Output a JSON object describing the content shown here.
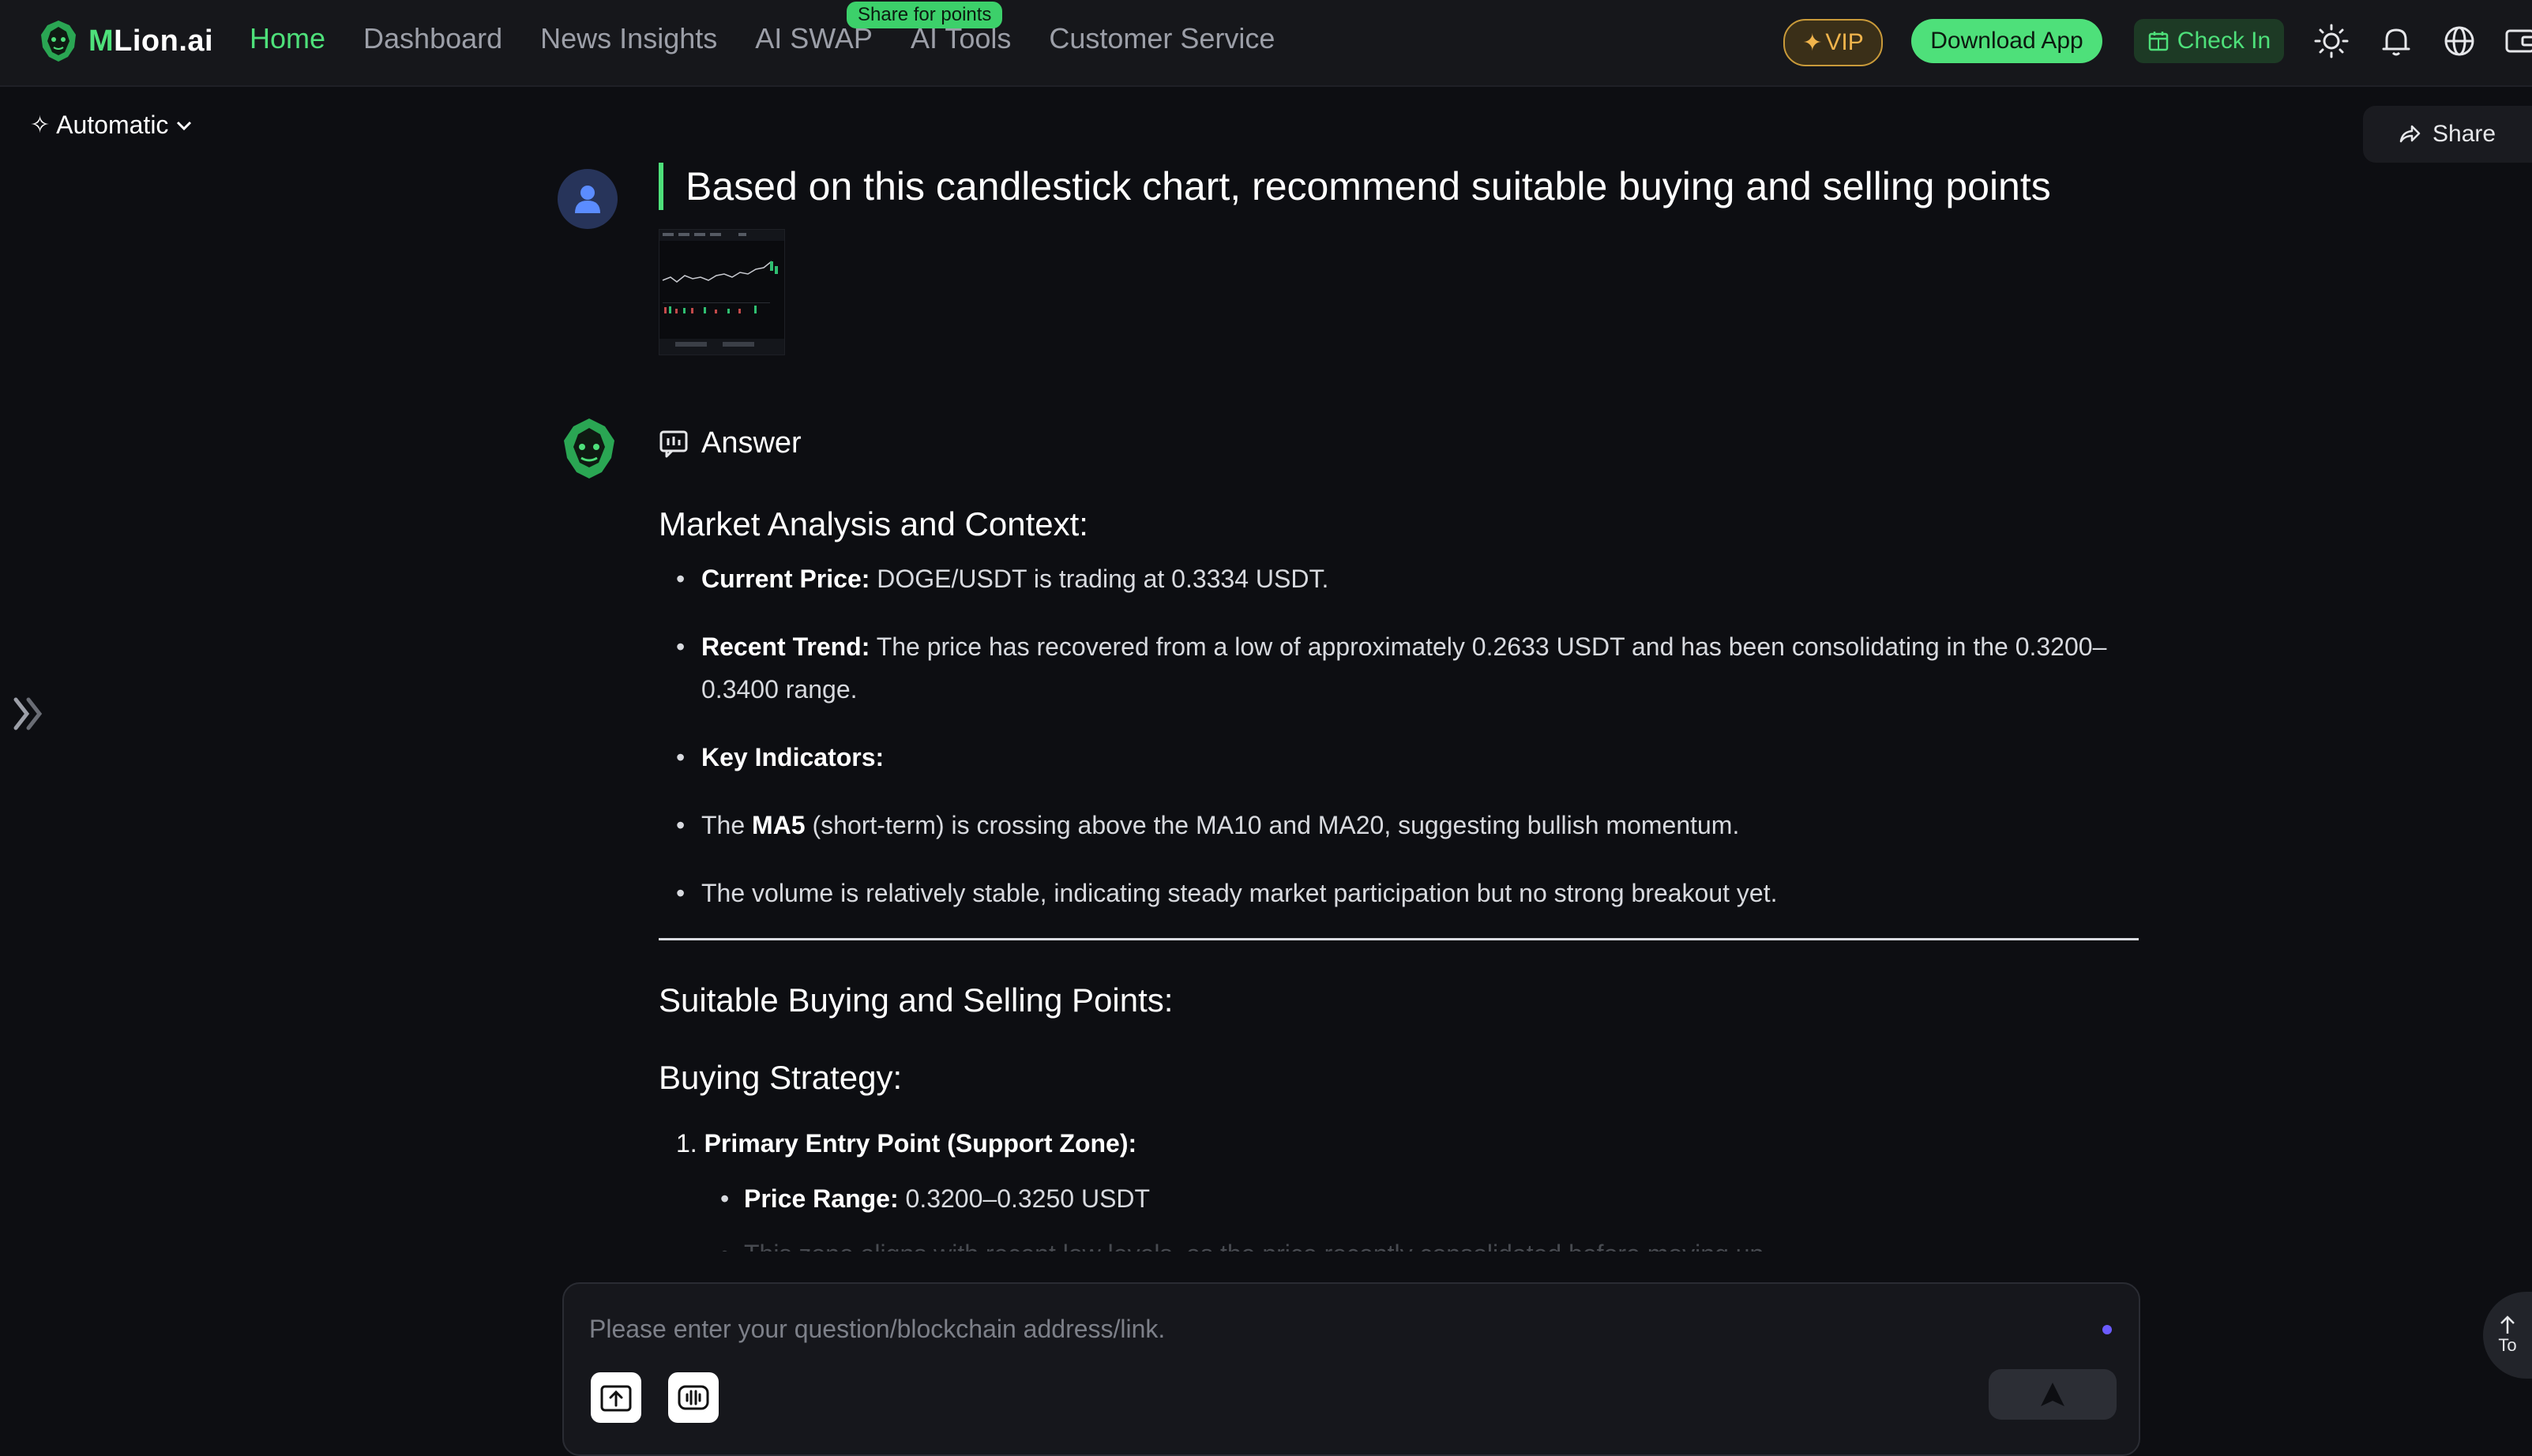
{
  "brand": {
    "logo_prefix": "M",
    "logo_rest": "Lion.ai"
  },
  "nav": {
    "items": [
      "Home",
      "Dashboard",
      "News Insights",
      "AI SWAP",
      "AI Tools",
      "Customer Service"
    ],
    "active": "Home",
    "promo_badge": "Share for points"
  },
  "header_actions": {
    "vip": "VIP",
    "download": "Download App",
    "checkin": "Check In"
  },
  "model_selector": {
    "label": "Automatic"
  },
  "share": {
    "label": "Share"
  },
  "question": {
    "text": "Based on this candlestick chart, recommend suitable buying and selling points"
  },
  "answer": {
    "header": "Answer",
    "section1_title": "Market Analysis and Context:",
    "b1_label": "Current Price:",
    "b1_text": " DOGE/USDT is trading at 0.3334 USDT.",
    "b2_label": "Recent Trend:",
    "b2_text": " The price has recovered from a low of approximately 0.2633 USDT and has been consolidating in the 0.3200–0.3400 range.",
    "b3_label": "Key Indicators:",
    "b4_pre": "The ",
    "b4_label": "MA5",
    "b4_text": " (short-term) is crossing above the MA10 and MA20, suggesting bullish momentum.",
    "b5_text": "The volume is relatively stable, indicating steady market participation but no strong breakout yet.",
    "section2_title": "Suitable Buying and Selling Points:",
    "section3_title": "Buying Strategy:",
    "ol1_num": "1.",
    "ol1_text": "Primary Entry Point (Support Zone):",
    "sub1_label": "Price Range:",
    "sub1_text": " 0.3200–0.3250 USDT",
    "cut_text": "This zone aligns with recent low levels, as the price recently consolidated before moving up."
  },
  "input": {
    "placeholder": "Please enter your question/blockchain address/link."
  },
  "to_top": {
    "label": "To"
  },
  "colors": {
    "accent": "#4ee07a",
    "background": "#0d0e12",
    "vip": "#f0b44c"
  }
}
